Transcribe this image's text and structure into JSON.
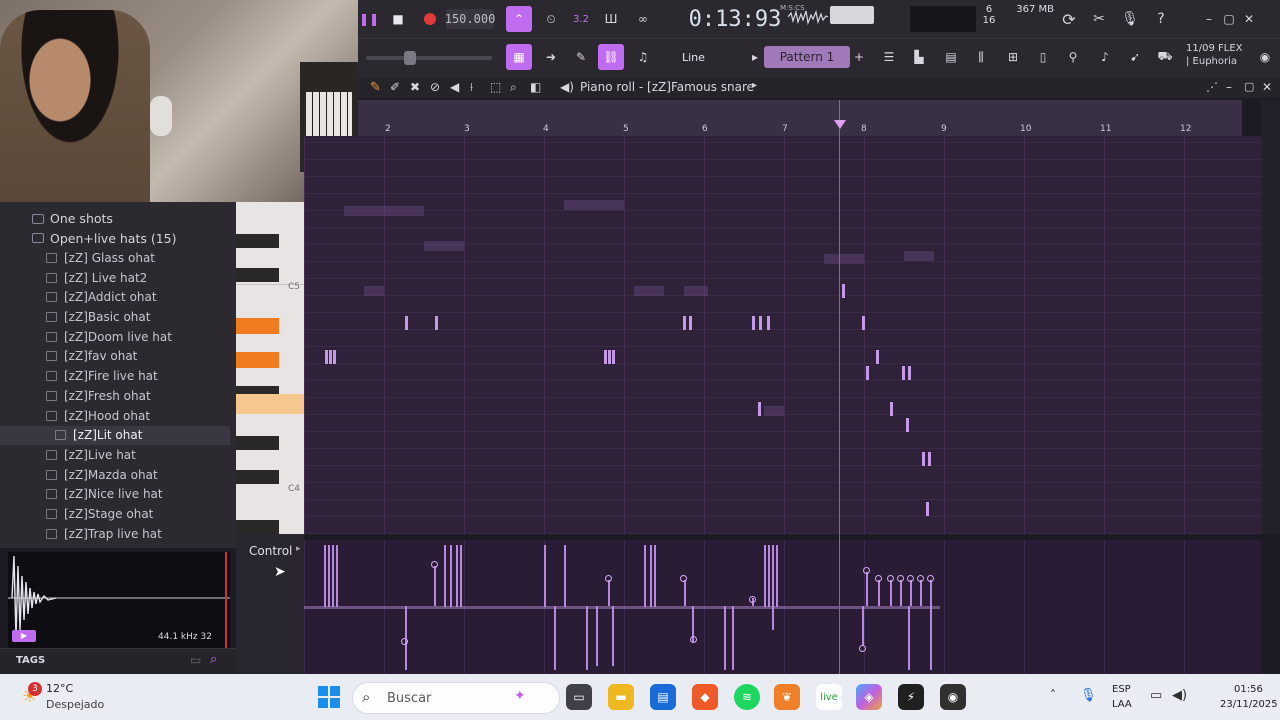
{
  "toolbar": {
    "tempo": "150.000",
    "time": "0:13:93",
    "time_label": "M:S:CS",
    "cpu": [
      "6",
      "16"
    ],
    "memory": "367 MB",
    "snap_mode": "Line",
    "pattern": "Pattern 1",
    "date_label": "11/09  FLEX",
    "preset_label": "| Euphoria"
  },
  "browser": {
    "items": [
      {
        "label": "One shots",
        "type": "folder"
      },
      {
        "label": "Open+live hats (15)",
        "type": "folder"
      },
      {
        "label": "[zZ] Glass ohat",
        "type": "file"
      },
      {
        "label": "[zZ] Live hat2",
        "type": "file"
      },
      {
        "label": "[zZ]Addict ohat",
        "type": "file"
      },
      {
        "label": "[zZ]Basic ohat",
        "type": "file"
      },
      {
        "label": "[zZ]Doom live hat",
        "type": "file"
      },
      {
        "label": "[zZ]fav ohat",
        "type": "file"
      },
      {
        "label": "[zZ]Fire live hat",
        "type": "file"
      },
      {
        "label": "[zZ]Fresh ohat",
        "type": "file"
      },
      {
        "label": "[zZ]Hood ohat",
        "type": "file"
      },
      {
        "label": "[zZ]Lit ohat",
        "type": "file",
        "selected": true
      },
      {
        "label": "[zZ]Live hat",
        "type": "file"
      },
      {
        "label": "[zZ]Mazda ohat",
        "type": "file"
      },
      {
        "label": "[zZ]Nice live hat",
        "type": "file"
      },
      {
        "label": "[zZ]Stage ohat",
        "type": "file"
      },
      {
        "label": "[zZ]Trap live hat",
        "type": "file"
      }
    ],
    "sample_info": "44.1 kHz 32",
    "tags_label": "TAGS"
  },
  "piano_roll": {
    "title": "Piano roll - [zZ]Famous snare",
    "ruler_numbers": [
      "2",
      "3",
      "4",
      "5",
      "6",
      "7",
      "8",
      "9",
      "10",
      "11",
      "12"
    ],
    "key_labels": [
      "C5",
      "C4"
    ],
    "control_label": "Control"
  },
  "taskbar": {
    "weather_temp": "12°C",
    "weather_desc": "Despejado",
    "weather_badge": "3",
    "search_placeholder": "Buscar",
    "lang": "ESP",
    "lang2": "LAA",
    "clock_time": "01:56",
    "clock_date": "23/11/2025"
  },
  "colors": {
    "accent": "#c06cf0",
    "grid_bg": "#2e2138",
    "note": "#c49ae8",
    "key_highlight": "#f07b20"
  }
}
